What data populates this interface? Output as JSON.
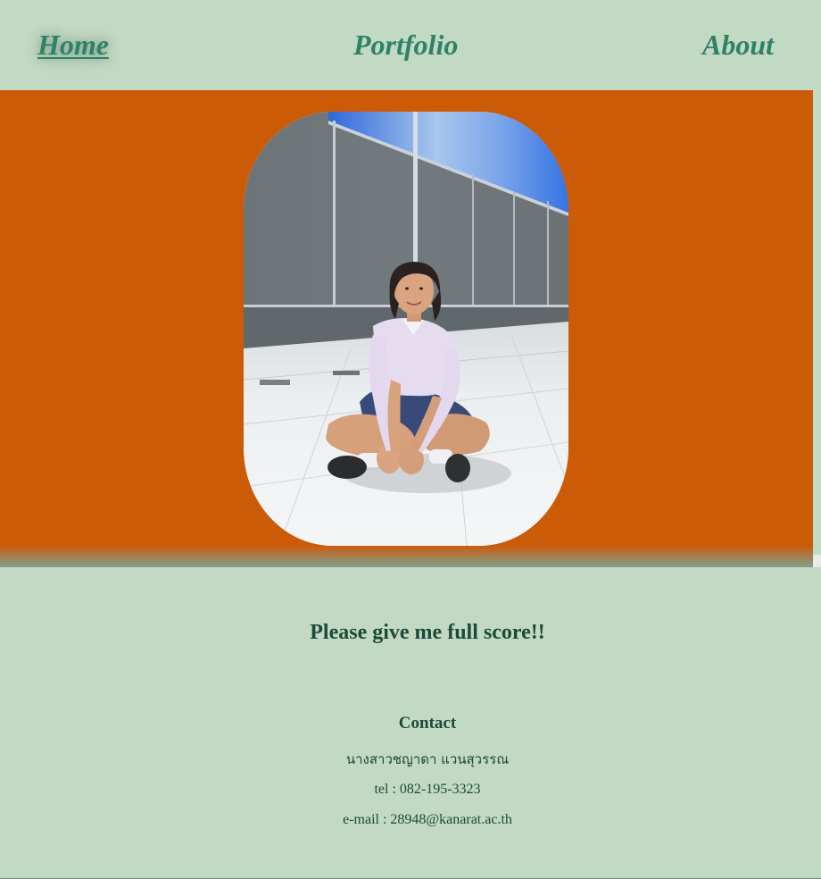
{
  "nav": {
    "home": "Home",
    "portfolio": "Portfolio",
    "about": "About"
  },
  "hero": {
    "image_label": "portrait-photo",
    "background_color": "#cc5b08"
  },
  "content": {
    "tagline": "Please give me full score!!",
    "contact_heading": "Contact",
    "contact_name": "นางสาวชญาดา แวนสุวรรณ",
    "contact_tel": "tel : 082-195-3323",
    "contact_email": "e-mail : 28948@kanarat.ac.th"
  },
  "colors": {
    "page_background": "#c2d9c3",
    "nav_link": "#2e8266",
    "text": "#1d4a3a"
  }
}
